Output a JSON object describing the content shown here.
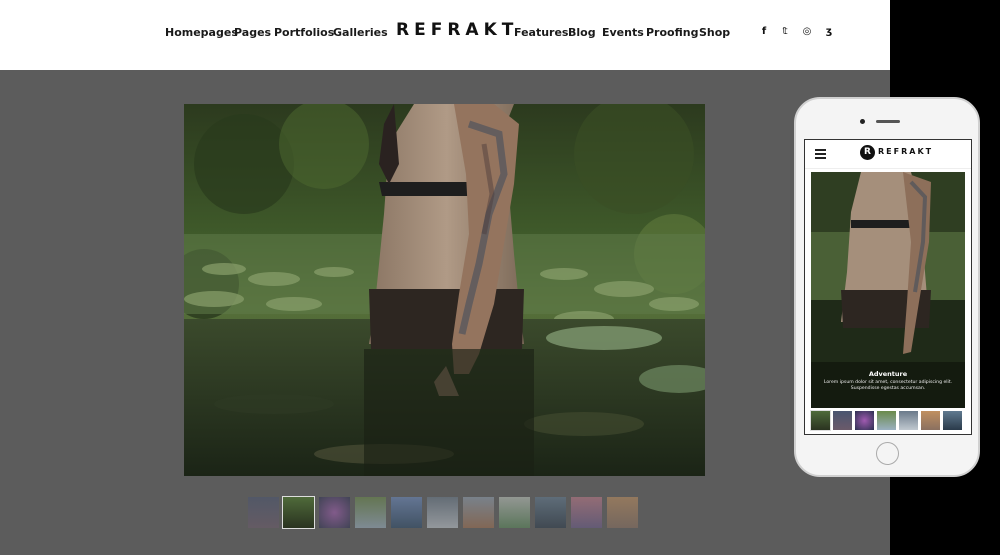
{
  "header": {
    "logo": "REFRAKT",
    "nav_left": [
      "Homepages",
      "Pages",
      "Portfolios",
      "Galleries"
    ],
    "nav_right": [
      "Features",
      "Blog",
      "Events",
      "Proofing",
      "Shop"
    ],
    "social_icons": [
      "facebook-icon",
      "twitter-icon",
      "instagram-icon",
      "500px-icon"
    ],
    "social_glyphs": [
      "f",
      "𝕥",
      "◎",
      "ʒ"
    ]
  },
  "gallery": {
    "thumbnail_count": 11,
    "active_thumbnail": 2
  },
  "phone": {
    "logo_mark": "R",
    "logo": "REFRAKT",
    "caption_title": "Adventure",
    "caption_text": "Lorem ipsum dolor sit amet, consectetur adipiscing elit. Suspendisse egestas accumsan.",
    "thumbnail_count": 7
  }
}
